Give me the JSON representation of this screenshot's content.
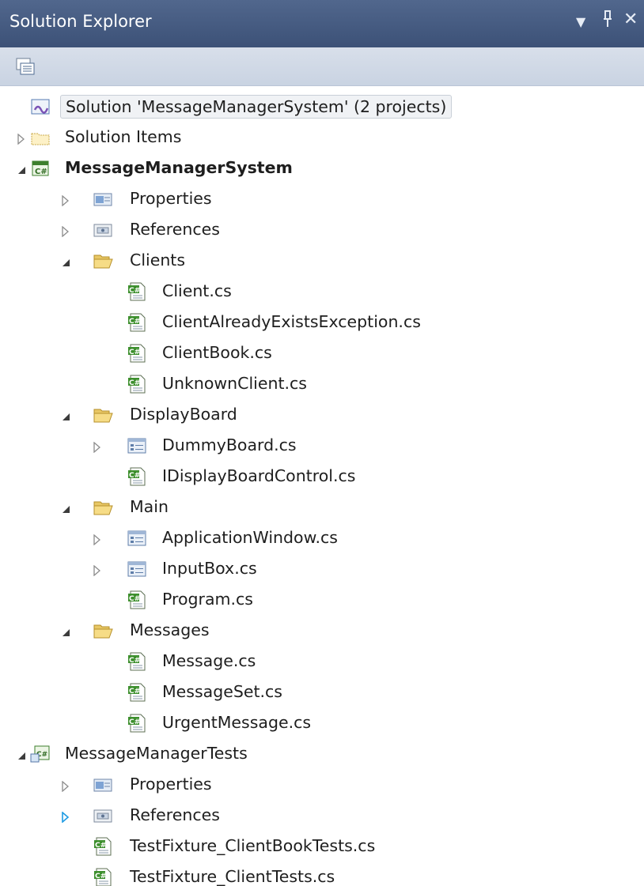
{
  "window": {
    "title": "Solution Explorer",
    "buttons": [
      {
        "name": "dropdown",
        "glyph": "▾"
      },
      {
        "name": "pin",
        "glyph": "ᵖ"
      },
      {
        "name": "close",
        "glyph": "✕"
      }
    ]
  },
  "toolbar": {
    "items": [
      {
        "name": "properties-toolbar-button",
        "icon": "properties-icon"
      }
    ]
  },
  "tree": [
    {
      "label": "Solution 'MessageManagerSystem' (2 projects)",
      "level": 0,
      "icon": "solution-icon",
      "expander": "none",
      "selected": true
    },
    {
      "label": "Solution Items",
      "level": 0,
      "icon": "solution-folder-icon",
      "expander": "collapsed"
    },
    {
      "label": "MessageManagerSystem",
      "level": 0,
      "icon": "csharp-project-icon",
      "expander": "expanded",
      "bold": true
    },
    {
      "label": "Properties",
      "level": 1,
      "icon": "properties-folder-icon",
      "expander": "collapsed"
    },
    {
      "label": "References",
      "level": 1,
      "icon": "references-icon",
      "expander": "collapsed"
    },
    {
      "label": "Clients",
      "level": 1,
      "icon": "open-folder-icon",
      "expander": "expanded"
    },
    {
      "label": "Client.cs",
      "level": 2,
      "icon": "csharp-file-icon",
      "expander": "none"
    },
    {
      "label": "ClientAlreadyExistsException.cs",
      "level": 2,
      "icon": "csharp-file-icon",
      "expander": "none"
    },
    {
      "label": "ClientBook.cs",
      "level": 2,
      "icon": "csharp-file-icon",
      "expander": "none"
    },
    {
      "label": "UnknownClient.cs",
      "level": 2,
      "icon": "csharp-file-icon",
      "expander": "none"
    },
    {
      "label": "DisplayBoard",
      "level": 1,
      "icon": "open-folder-icon",
      "expander": "expanded"
    },
    {
      "label": "DummyBoard.cs",
      "level": 2,
      "icon": "form-file-icon",
      "expander": "collapsed"
    },
    {
      "label": "IDisplayBoardControl.cs",
      "level": 2,
      "icon": "csharp-file-icon",
      "expander": "none"
    },
    {
      "label": "Main",
      "level": 1,
      "icon": "open-folder-icon",
      "expander": "expanded"
    },
    {
      "label": "ApplicationWindow.cs",
      "level": 2,
      "icon": "form-file-icon",
      "expander": "collapsed"
    },
    {
      "label": "InputBox.cs",
      "level": 2,
      "icon": "form-file-icon",
      "expander": "collapsed"
    },
    {
      "label": "Program.cs",
      "level": 2,
      "icon": "csharp-file-icon",
      "expander": "none"
    },
    {
      "label": "Messages",
      "level": 1,
      "icon": "open-folder-icon",
      "expander": "expanded"
    },
    {
      "label": "Message.cs",
      "level": 2,
      "icon": "csharp-file-icon",
      "expander": "none"
    },
    {
      "label": "MessageSet.cs",
      "level": 2,
      "icon": "csharp-file-icon",
      "expander": "none"
    },
    {
      "label": "UrgentMessage.cs",
      "level": 2,
      "icon": "csharp-file-icon",
      "expander": "none"
    },
    {
      "label": "MessageManagerTests",
      "level": 0,
      "icon": "csharp-test-project-icon",
      "expander": "expanded"
    },
    {
      "label": "Properties",
      "level": 1,
      "icon": "properties-folder-icon",
      "expander": "collapsed"
    },
    {
      "label": "References",
      "level": 1,
      "icon": "references-icon",
      "expander": "collapsed-hover"
    },
    {
      "label": "TestFixture_ClientBookTests.cs",
      "level": 1,
      "icon": "csharp-file-icon",
      "expander": "none"
    },
    {
      "label": "TestFixture_ClientTests.cs",
      "level": 1,
      "icon": "csharp-file-icon",
      "expander": "none"
    }
  ]
}
